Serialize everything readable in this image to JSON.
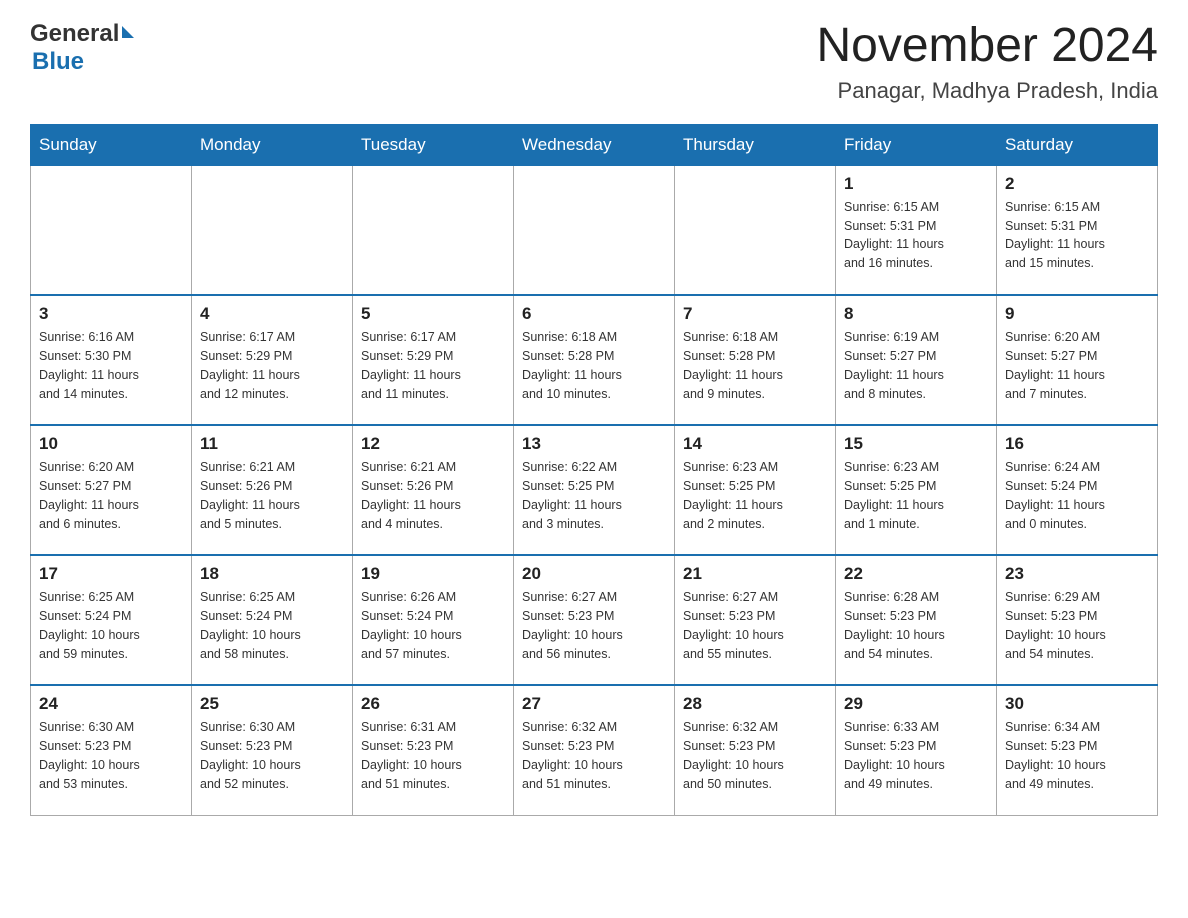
{
  "header": {
    "logo_text_general": "General",
    "logo_text_blue": "Blue",
    "title": "November 2024",
    "subtitle": "Panagar, Madhya Pradesh, India"
  },
  "calendar": {
    "days_of_week": [
      "Sunday",
      "Monday",
      "Tuesday",
      "Wednesday",
      "Thursday",
      "Friday",
      "Saturday"
    ],
    "weeks": [
      {
        "cells": [
          {
            "day": "",
            "info": ""
          },
          {
            "day": "",
            "info": ""
          },
          {
            "day": "",
            "info": ""
          },
          {
            "day": "",
            "info": ""
          },
          {
            "day": "",
            "info": ""
          },
          {
            "day": "1",
            "info": "Sunrise: 6:15 AM\nSunset: 5:31 PM\nDaylight: 11 hours\nand 16 minutes."
          },
          {
            "day": "2",
            "info": "Sunrise: 6:15 AM\nSunset: 5:31 PM\nDaylight: 11 hours\nand 15 minutes."
          }
        ]
      },
      {
        "cells": [
          {
            "day": "3",
            "info": "Sunrise: 6:16 AM\nSunset: 5:30 PM\nDaylight: 11 hours\nand 14 minutes."
          },
          {
            "day": "4",
            "info": "Sunrise: 6:17 AM\nSunset: 5:29 PM\nDaylight: 11 hours\nand 12 minutes."
          },
          {
            "day": "5",
            "info": "Sunrise: 6:17 AM\nSunset: 5:29 PM\nDaylight: 11 hours\nand 11 minutes."
          },
          {
            "day": "6",
            "info": "Sunrise: 6:18 AM\nSunset: 5:28 PM\nDaylight: 11 hours\nand 10 minutes."
          },
          {
            "day": "7",
            "info": "Sunrise: 6:18 AM\nSunset: 5:28 PM\nDaylight: 11 hours\nand 9 minutes."
          },
          {
            "day": "8",
            "info": "Sunrise: 6:19 AM\nSunset: 5:27 PM\nDaylight: 11 hours\nand 8 minutes."
          },
          {
            "day": "9",
            "info": "Sunrise: 6:20 AM\nSunset: 5:27 PM\nDaylight: 11 hours\nand 7 minutes."
          }
        ]
      },
      {
        "cells": [
          {
            "day": "10",
            "info": "Sunrise: 6:20 AM\nSunset: 5:27 PM\nDaylight: 11 hours\nand 6 minutes."
          },
          {
            "day": "11",
            "info": "Sunrise: 6:21 AM\nSunset: 5:26 PM\nDaylight: 11 hours\nand 5 minutes."
          },
          {
            "day": "12",
            "info": "Sunrise: 6:21 AM\nSunset: 5:26 PM\nDaylight: 11 hours\nand 4 minutes."
          },
          {
            "day": "13",
            "info": "Sunrise: 6:22 AM\nSunset: 5:25 PM\nDaylight: 11 hours\nand 3 minutes."
          },
          {
            "day": "14",
            "info": "Sunrise: 6:23 AM\nSunset: 5:25 PM\nDaylight: 11 hours\nand 2 minutes."
          },
          {
            "day": "15",
            "info": "Sunrise: 6:23 AM\nSunset: 5:25 PM\nDaylight: 11 hours\nand 1 minute."
          },
          {
            "day": "16",
            "info": "Sunrise: 6:24 AM\nSunset: 5:24 PM\nDaylight: 11 hours\nand 0 minutes."
          }
        ]
      },
      {
        "cells": [
          {
            "day": "17",
            "info": "Sunrise: 6:25 AM\nSunset: 5:24 PM\nDaylight: 10 hours\nand 59 minutes."
          },
          {
            "day": "18",
            "info": "Sunrise: 6:25 AM\nSunset: 5:24 PM\nDaylight: 10 hours\nand 58 minutes."
          },
          {
            "day": "19",
            "info": "Sunrise: 6:26 AM\nSunset: 5:24 PM\nDaylight: 10 hours\nand 57 minutes."
          },
          {
            "day": "20",
            "info": "Sunrise: 6:27 AM\nSunset: 5:23 PM\nDaylight: 10 hours\nand 56 minutes."
          },
          {
            "day": "21",
            "info": "Sunrise: 6:27 AM\nSunset: 5:23 PM\nDaylight: 10 hours\nand 55 minutes."
          },
          {
            "day": "22",
            "info": "Sunrise: 6:28 AM\nSunset: 5:23 PM\nDaylight: 10 hours\nand 54 minutes."
          },
          {
            "day": "23",
            "info": "Sunrise: 6:29 AM\nSunset: 5:23 PM\nDaylight: 10 hours\nand 54 minutes."
          }
        ]
      },
      {
        "cells": [
          {
            "day": "24",
            "info": "Sunrise: 6:30 AM\nSunset: 5:23 PM\nDaylight: 10 hours\nand 53 minutes."
          },
          {
            "day": "25",
            "info": "Sunrise: 6:30 AM\nSunset: 5:23 PM\nDaylight: 10 hours\nand 52 minutes."
          },
          {
            "day": "26",
            "info": "Sunrise: 6:31 AM\nSunset: 5:23 PM\nDaylight: 10 hours\nand 51 minutes."
          },
          {
            "day": "27",
            "info": "Sunrise: 6:32 AM\nSunset: 5:23 PM\nDaylight: 10 hours\nand 51 minutes."
          },
          {
            "day": "28",
            "info": "Sunrise: 6:32 AM\nSunset: 5:23 PM\nDaylight: 10 hours\nand 50 minutes."
          },
          {
            "day": "29",
            "info": "Sunrise: 6:33 AM\nSunset: 5:23 PM\nDaylight: 10 hours\nand 49 minutes."
          },
          {
            "day": "30",
            "info": "Sunrise: 6:34 AM\nSunset: 5:23 PM\nDaylight: 10 hours\nand 49 minutes."
          }
        ]
      }
    ]
  }
}
